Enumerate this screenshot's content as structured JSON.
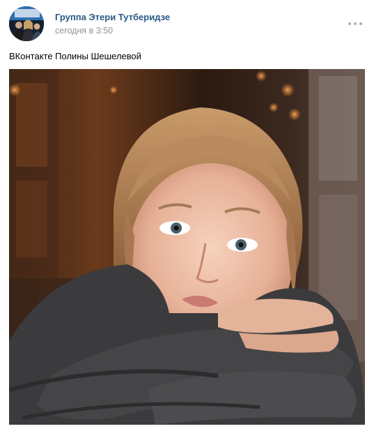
{
  "post": {
    "author": "Группа Этери Тутберидзе",
    "time": "сегодня в 3:50",
    "text": "ВКонтакте Полины Шешелевой"
  },
  "icons": {
    "more": "more-dots-icon"
  },
  "colors": {
    "author_link": "#2a5885",
    "meta_text": "#939393",
    "body_text": "#000000",
    "more_dots": "#aab3bd"
  }
}
